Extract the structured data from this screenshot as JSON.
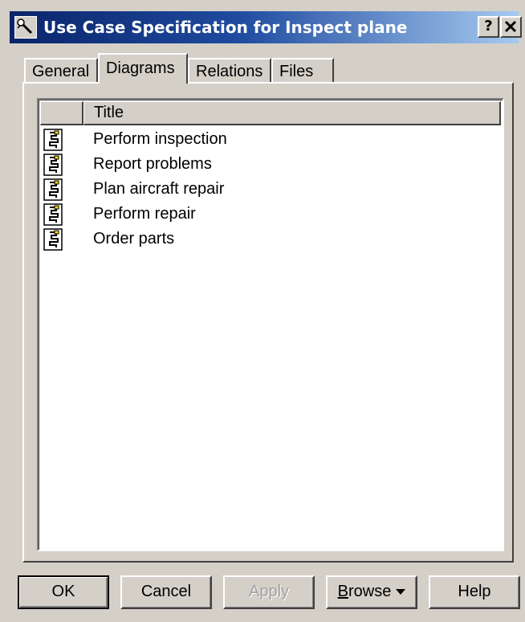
{
  "window": {
    "title": "Use Case Specification for Inspect plane",
    "title_icon": "use-case-spec-icon",
    "help_glyph": "?",
    "close_glyph": "✕"
  },
  "tabs": [
    {
      "label": "General",
      "active": false
    },
    {
      "label": "Diagrams",
      "active": true
    },
    {
      "label": "Relations",
      "active": false
    },
    {
      "label": "Files",
      "active": false
    }
  ],
  "list": {
    "columns": [
      "",
      "Title"
    ],
    "rows": [
      {
        "icon": "activity-diagram-icon",
        "title": "Perform inspection"
      },
      {
        "icon": "activity-diagram-icon",
        "title": "Report problems"
      },
      {
        "icon": "activity-diagram-icon",
        "title": "Plan aircraft repair"
      },
      {
        "icon": "activity-diagram-icon",
        "title": "Perform repair"
      },
      {
        "icon": "activity-diagram-icon",
        "title": "Order parts"
      }
    ]
  },
  "buttons": {
    "ok": "OK",
    "cancel": "Cancel",
    "apply": "Apply",
    "browse_underline": "B",
    "browse_rest": "rowse",
    "help": "Help"
  },
  "colors": {
    "titlebar_start": "#0a246a",
    "titlebar_end": "#a6caf0",
    "face": "#d4d0c8"
  }
}
